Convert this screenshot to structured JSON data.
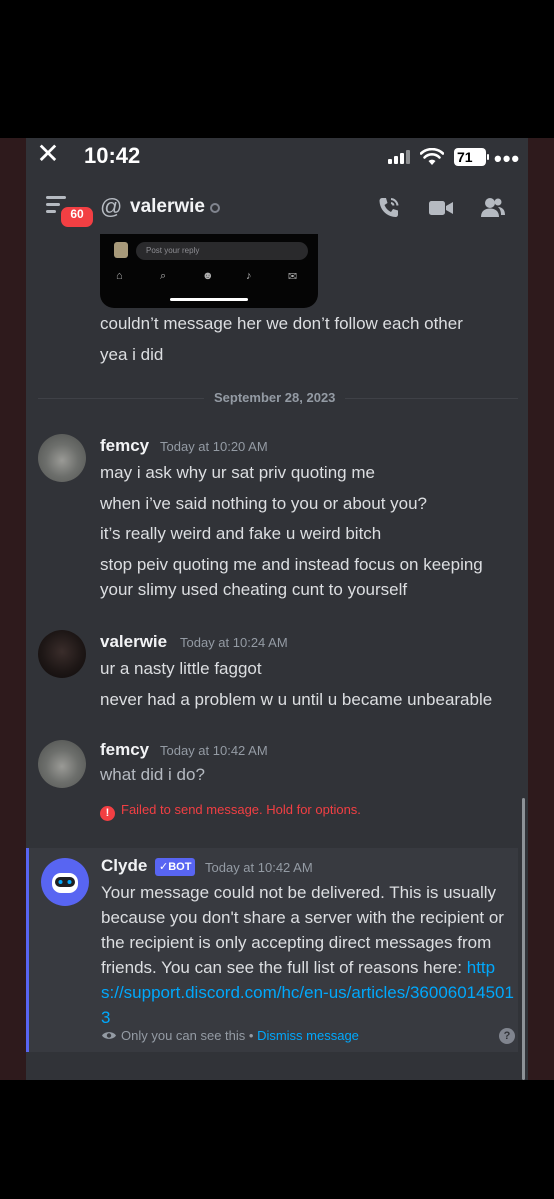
{
  "status_bar": {
    "time": "10:42",
    "battery": "71",
    "more": "•••"
  },
  "header": {
    "badge_count": "60",
    "at_symbol": "@",
    "channel_name": "valerwie"
  },
  "preview": {
    "reply_placeholder": "Post your reply"
  },
  "prior_lines": [
    "couldn’t message her we don’t follow each other",
    "yea i did"
  ],
  "date_divider": "September 28, 2023",
  "messages": [
    {
      "author": "femcy",
      "timestamp": "Today at 10:20 AM",
      "lines": [
        "may i ask why ur sat priv quoting me",
        "when i’ve said nothing to you or about you?",
        "it’s really weird and fake u weird bitch",
        "stop peiv quoting me and instead focus on keeping your slimy used cheating cunt to yourself"
      ]
    },
    {
      "author": "valerwie",
      "timestamp": "Today at 10:24 AM",
      "lines": [
        "ur a nasty little faggot",
        "never had a problem w u until u became unbearable"
      ]
    },
    {
      "author": "femcy",
      "timestamp": "Today at 10:42 AM",
      "lines": [
        "what did i do?"
      ]
    }
  ],
  "error": {
    "icon": "!",
    "text": "Failed to send message. Hold for options."
  },
  "clyde": {
    "author": "Clyde",
    "bot_tag": "✓BOT",
    "timestamp": "Today at 10:42 AM",
    "text": "Your message could not be delivered. This is usually because you don't share a server with the recipient or the recipient is only accepting direct messages from friends. You can see the full list of reasons here: ",
    "link": "https://support.discord.com/hc/en-us/articles/360060145013",
    "ephemeral_note": "Only you can see this • ",
    "dismiss_label": "Dismiss message",
    "help_icon": "?"
  },
  "colors": {
    "background": "#313338",
    "error": "#f23f43",
    "link": "#00a8fc",
    "blurple": "#5865f2"
  }
}
